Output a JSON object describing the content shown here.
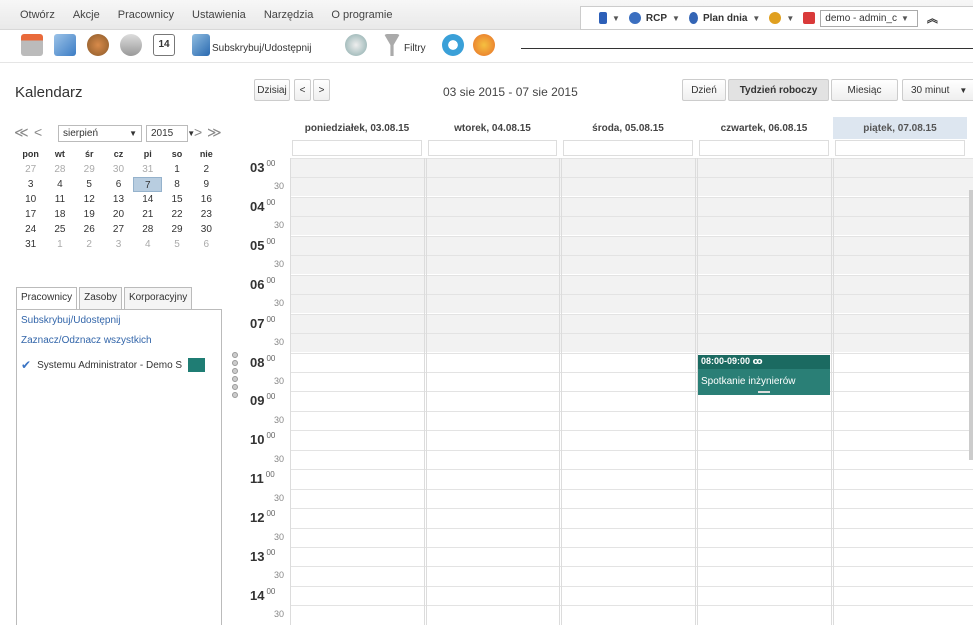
{
  "menu": [
    "Otwórz",
    "Akcje",
    "Pracownicy",
    "Ustawienia",
    "Narzędzia",
    "O programie"
  ],
  "rightbar": {
    "rcp": "RCP",
    "plan": "Plan dnia",
    "user": "demo - admin_c"
  },
  "toolbar": {
    "subscribe": "Subskrybuj/Udostępnij",
    "filters": "Filtry",
    "date_icon": "14"
  },
  "header": {
    "title": "Kalendarz",
    "today": "Dzisiaj",
    "prev": "<",
    "next": ">",
    "range": "03 sie 2015 - 07 sie 2015",
    "views": [
      "Dzień",
      "Tydzień roboczy",
      "Miesiąc"
    ],
    "active_view": "Tydzień roboczy",
    "interval": "30 minut"
  },
  "minical": {
    "prev_year": "≪",
    "prev": "<",
    "next": ">",
    "next_year": "≫",
    "month": "sierpień",
    "year": "2015",
    "weekdays": [
      "pon",
      "wt",
      "śr",
      "cz",
      "pi",
      "so",
      "nie"
    ],
    "weeks": [
      [
        "27",
        "28",
        "29",
        "30",
        "31",
        "1",
        "2"
      ],
      [
        "3",
        "4",
        "5",
        "6",
        "7",
        "8",
        "9"
      ],
      [
        "10",
        "11",
        "12",
        "13",
        "14",
        "15",
        "16"
      ],
      [
        "17",
        "18",
        "19",
        "20",
        "21",
        "22",
        "23"
      ],
      [
        "24",
        "25",
        "26",
        "27",
        "28",
        "29",
        "30"
      ],
      [
        "31",
        "1",
        "2",
        "3",
        "4",
        "5",
        "6"
      ]
    ],
    "selected": "7"
  },
  "tabs": [
    "Pracownicy",
    "Zasoby",
    "Korporacyjny"
  ],
  "panel": {
    "subscribe_link": "Subskrybuj/Udostępnij",
    "toggle_link": "Zaznacz/Odznacz wszystkich",
    "person": "Systemu Administrator - Demo S",
    "person_color": "#1f7d74"
  },
  "days": [
    "poniedziałek, 03.08.15",
    "wtorek, 04.08.15",
    "środa, 05.08.15",
    "czwartek, 06.08.15",
    "piątek, 07.08.15"
  ],
  "hours": [
    "03",
    "04",
    "05",
    "06",
    "07",
    "08",
    "09",
    "10",
    "11",
    "12",
    "13",
    "14"
  ],
  "minute_full": "00",
  "minute_half": "30",
  "event": {
    "time": "08:00-09:00",
    "title": "Spotkanie inżynierów",
    "color": "#2a7f76"
  }
}
